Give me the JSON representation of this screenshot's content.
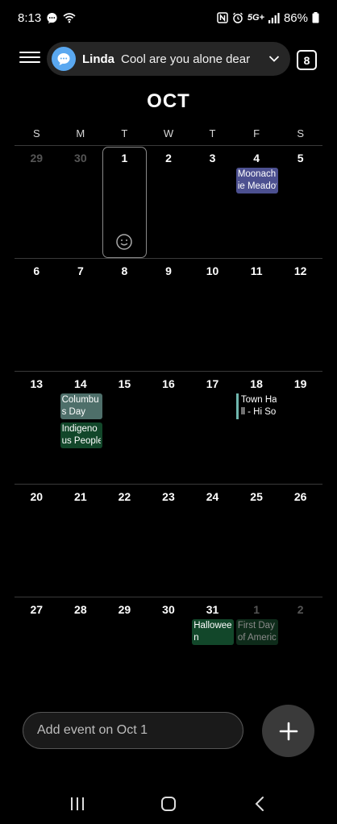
{
  "status_bar": {
    "time": "8:13",
    "battery": "86%",
    "network": "5G+"
  },
  "header": {
    "notification": {
      "name": "Linda",
      "message": "Cool are you alone dear"
    },
    "today_button": "8"
  },
  "month_title": "OCT",
  "weekdays": [
    "S",
    "M",
    "T",
    "W",
    "T",
    "F",
    "S"
  ],
  "weeks": [
    [
      "29",
      "30",
      "1",
      "2",
      "3",
      "4",
      "5"
    ],
    [
      "6",
      "7",
      "8",
      "9",
      "10",
      "11",
      "12"
    ],
    [
      "13",
      "14",
      "15",
      "16",
      "17",
      "18",
      "19"
    ],
    [
      "20",
      "21",
      "22",
      "23",
      "24",
      "25",
      "26"
    ],
    [
      "27",
      "28",
      "29",
      "30",
      "31",
      "1",
      "2"
    ]
  ],
  "events": {
    "moonachie": [
      "Moonach",
      "ie Meadov"
    ],
    "columbus": [
      "Columbu",
      "s Day"
    ],
    "indigenous": [
      "Indigeno",
      "us People"
    ],
    "townhall": [
      "Town Ha",
      "ll - Hi Sol"
    ],
    "halloween": [
      "Hallowee",
      "n"
    ],
    "first_day": [
      "First Day",
      "of Americ"
    ]
  },
  "add_event": {
    "placeholder": "Add event on Oct 1"
  },
  "colors": {
    "background": "#000000",
    "moonachie_event": "#4c5090",
    "columbus_event": "#4e6f6a",
    "holiday_event": "#12472a",
    "fab": "#3a3a3a"
  }
}
